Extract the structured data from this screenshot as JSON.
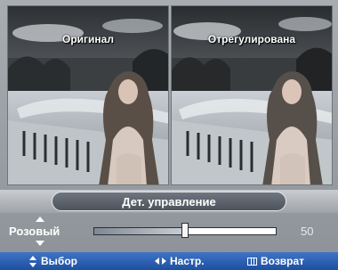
{
  "preview": {
    "original_label": "Оригинал",
    "adjusted_label": "Отрегулирована"
  },
  "mode": {
    "title": "Дет. управление"
  },
  "adjustment": {
    "label": "Розовый",
    "value": "50",
    "level_percent": 50
  },
  "footer": {
    "select_label": "Выбор",
    "adjust_label": "Настр.",
    "back_label": "Возврат"
  },
  "icons": {
    "up": "triangle-up-icon",
    "down": "triangle-down-icon",
    "select": "up-down-arrows-icon",
    "adjust": "left-right-arrows-icon",
    "back": "menu-icon"
  },
  "colors": {
    "footer_bar": "#2f63b8",
    "slider_track": "#2a2f35"
  }
}
